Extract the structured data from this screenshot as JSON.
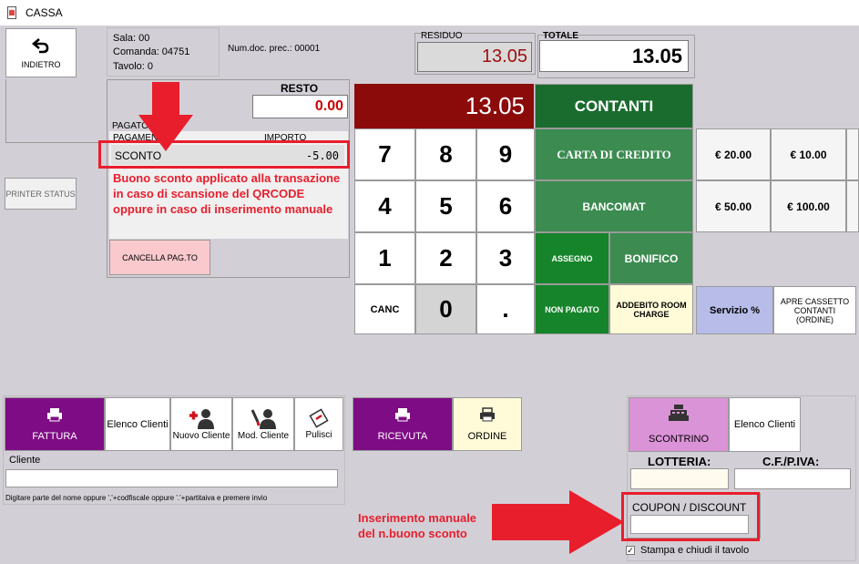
{
  "window": {
    "title": "CASSA"
  },
  "left": {
    "back_label": "INDIETRO",
    "printer_status": "PRINTER STATUS"
  },
  "info": {
    "sala": "Sala: 00",
    "comanda": "Comanda: 04751",
    "tavolo": "Tavolo:  0",
    "num_doc": "Num.doc. prec.: 00001"
  },
  "totals": {
    "residuo_label": "RESIDUO",
    "residuo_value": "13.05",
    "totale_label": "TOTALE",
    "totale_value": "13.05"
  },
  "payments": {
    "resto_label": "RESTO",
    "resto_value": "0.00",
    "pagato_label": "PAGATO",
    "col_pagamento": "PAGAMENTO",
    "col_importo": "IMPORTO",
    "rows": [
      {
        "name": "SCONTO",
        "amount": "-5.00"
      }
    ],
    "cancel_label": "CANCELLA PAG.TO"
  },
  "keypad": {
    "display": "13.05",
    "keys": [
      "7",
      "8",
      "9",
      "4",
      "5",
      "6",
      "1",
      "2",
      "3",
      "CANC",
      "0",
      "."
    ]
  },
  "methods": {
    "contanti": "CONTANTI",
    "carta": "CARTA DI CREDITO",
    "bancomat": "BANCOMAT",
    "assegno": "ASSEGNO",
    "bonifico": "BONIFICO",
    "non_pagato": "NON PAGATO",
    "addebito": "ADDEBITO ROOM CHARGE"
  },
  "quick": {
    "e20": "€ 20.00",
    "e10": "€ 10.00",
    "e50": "€ 50.00",
    "e100": "€ 100.00",
    "servizio": "Servizio  %",
    "apre_cassetto": "APRE CASSETTO CONTANTI (ORDINE)"
  },
  "invoice": {
    "fattura": "FATTURA",
    "elenco_clienti": "Elenco Clienti",
    "nuovo_cliente": "Nuovo Cliente",
    "mod_cliente": "Mod. Cliente",
    "pulisci": "Pulisci",
    "cliente_label": "Cliente",
    "cliente_value": "",
    "hint": "Digitare parte del nome oppure ','+codfiscale oppure '.'+partitaiva e premere invio"
  },
  "doc": {
    "ricevuta": "RICEVUTA",
    "ordine": "ORDINE"
  },
  "receipt": {
    "scontrino": "SCONTRINO",
    "elenco_clienti": "Elenco Clienti",
    "lotteria_label": "LOTTERIA:",
    "cf_label": "C.F./P.IVA:",
    "coupon_label": "COUPON / DISCOUNT",
    "stampa_label": "Stampa e chiudi il tavolo",
    "stampa_checked": true
  },
  "annotations": {
    "a1_lines": [
      "Buono sconto applicato alla transazione",
      "in caso di scansione del QRCODE",
      "oppure in caso di inserimento manuale"
    ],
    "a2_lines": [
      "Inserimento manuale",
      "del n.buono sconto"
    ]
  },
  "colors": {
    "accent_red": "#e81e2d",
    "purple": "#7e0c84",
    "green": "#3c8b50",
    "dark_red": "#8b0b0b"
  }
}
